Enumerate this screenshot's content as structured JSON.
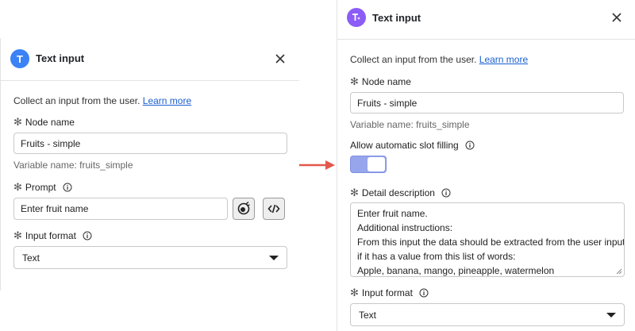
{
  "left": {
    "title": "Text input",
    "badge": "T",
    "description": "Collect an input from the user.",
    "learn_more": "Learn more",
    "node_name": {
      "label": "Node name",
      "value": "Fruits - simple"
    },
    "variable_name": "Variable name: fruits_simple",
    "prompt": {
      "label": "Prompt",
      "value": "Enter fruit name"
    },
    "input_format": {
      "label": "Input format",
      "value": "Text"
    }
  },
  "right": {
    "title": "Text input",
    "description": "Collect an input from the user.",
    "learn_more": "Learn more",
    "node_name": {
      "label": "Node name",
      "value": "Fruits - simple"
    },
    "variable_name": "Variable name: fruits_simple",
    "slot_filling": {
      "label": "Allow automatic slot filling",
      "enabled": true
    },
    "detail_description": {
      "label": "Detail description",
      "lines": [
        "Enter fruit name.",
        "Additional instructions:",
        "From this input the data should be extracted from the user input",
        "if it has a value from this list of words:",
        "Apple, banana, mango, pineapple, watermelon"
      ]
    },
    "input_format": {
      "label": "Input format",
      "value": "Text"
    }
  },
  "colors": {
    "accent_blue": "#3b82f6",
    "accent_purple": "#8b5cf6",
    "arrow_red": "#e2574c",
    "toggle_on": "#97a5ec",
    "link": "#1a5fd0"
  },
  "icons": [
    "text-input-icon",
    "close-icon",
    "info-icon",
    "ai-assist-icon",
    "code-icon",
    "chevron-down-icon",
    "arrow-right-icon"
  ]
}
